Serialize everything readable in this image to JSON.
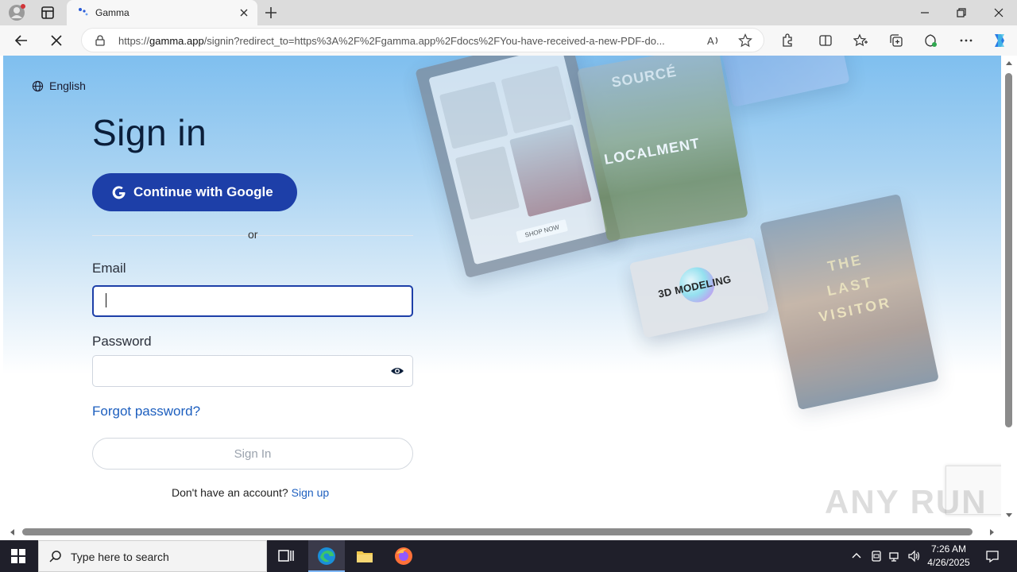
{
  "browser": {
    "tab_title": "Gamma",
    "url_prefix": "https://",
    "url_host": "gamma.app",
    "url_rest": "/signin?redirect_to=https%3A%2F%2Fgamma.app%2Fdocs%2FYou-have-received-a-new-PDF-do..."
  },
  "page": {
    "language": "English",
    "title": "Sign in",
    "google_button": "Continue with Google",
    "or_text": "or",
    "email_label": "Email",
    "email_value": "",
    "password_label": "Password",
    "password_value": "",
    "forgot_password": "Forgot password?",
    "signin_button": "Sign In",
    "no_account_text": "Don't have an account?",
    "signup_link": "Sign up"
  },
  "collage": {
    "shop_now": "SHOP NOW",
    "source": "SOURCÉ",
    "localment": "LOCALMENT",
    "modeling": "3D MODELING",
    "visitor": "THE LAST VISITOR"
  },
  "watermark": "ANY RUN",
  "taskbar": {
    "search_placeholder": "Type here to search",
    "time": "7:26 AM",
    "date": "4/26/2025"
  },
  "colors": {
    "primary": "#1d3fa8",
    "link": "#1d5fbf",
    "title": "#0b1e3a"
  }
}
